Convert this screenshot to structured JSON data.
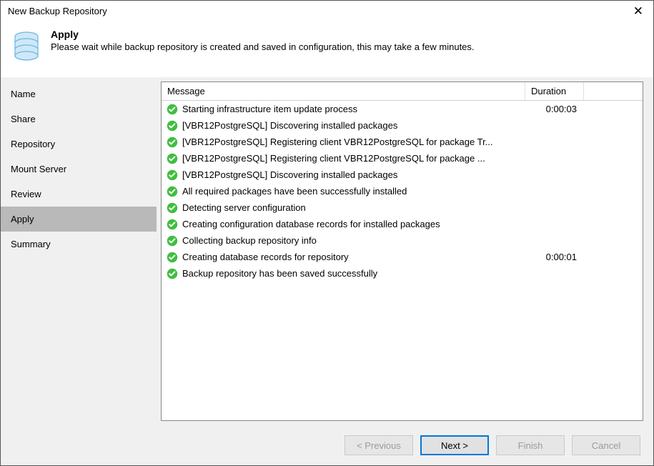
{
  "window": {
    "title": "New Backup Repository"
  },
  "header": {
    "heading": "Apply",
    "subtext": "Please wait while backup repository is created and saved in configuration, this may take a few minutes."
  },
  "sidebar": {
    "steps": [
      {
        "label": "Name",
        "active": false
      },
      {
        "label": "Share",
        "active": false
      },
      {
        "label": "Repository",
        "active": false
      },
      {
        "label": "Mount Server",
        "active": false
      },
      {
        "label": "Review",
        "active": false
      },
      {
        "label": "Apply",
        "active": true
      },
      {
        "label": "Summary",
        "active": false
      }
    ]
  },
  "grid": {
    "columns": {
      "message": "Message",
      "duration": "Duration"
    },
    "rows": [
      {
        "status": "ok",
        "message": "Starting infrastructure item update process",
        "duration": "0:00:03"
      },
      {
        "status": "ok",
        "message": "[VBR12PostgreSQL] Discovering installed packages",
        "duration": ""
      },
      {
        "status": "ok",
        "message": "[VBR12PostgreSQL] Registering client VBR12PostgreSQL for package Tr...",
        "duration": ""
      },
      {
        "status": "ok",
        "message": "[VBR12PostgreSQL] Registering client VBR12PostgreSQL for package ...",
        "duration": ""
      },
      {
        "status": "ok",
        "message": "[VBR12PostgreSQL] Discovering installed packages",
        "duration": ""
      },
      {
        "status": "ok",
        "message": "All required packages have been successfully installed",
        "duration": ""
      },
      {
        "status": "ok",
        "message": "Detecting server configuration",
        "duration": ""
      },
      {
        "status": "ok",
        "message": "Creating configuration database records for installed packages",
        "duration": ""
      },
      {
        "status": "ok",
        "message": "Collecting backup repository info",
        "duration": ""
      },
      {
        "status": "ok",
        "message": "Creating database records for repository",
        "duration": "0:00:01"
      },
      {
        "status": "ok",
        "message": "Backup repository has been saved successfully",
        "duration": ""
      }
    ]
  },
  "buttons": {
    "previous": "< Previous",
    "next": "Next >",
    "finish": "Finish",
    "cancel": "Cancel"
  },
  "colors": {
    "accent": "#0078d7",
    "successGreen": "#3fbf3f"
  }
}
